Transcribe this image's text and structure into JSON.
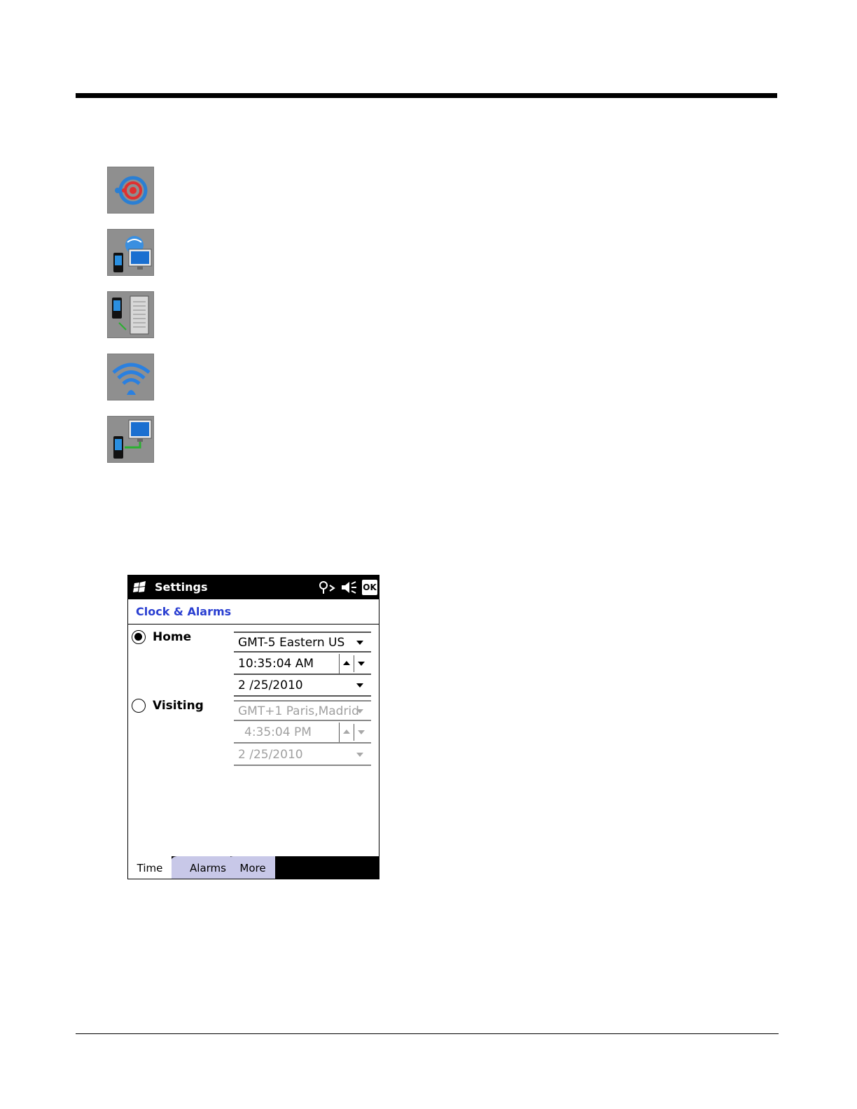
{
  "device_icons": [
    {
      "name": "bluetooth-discovery-icon"
    },
    {
      "name": "network-connection-icon"
    },
    {
      "name": "device-server-sync-icon"
    },
    {
      "name": "wireless-signal-icon"
    },
    {
      "name": "pc-connection-icon"
    }
  ],
  "phone": {
    "titlebar": {
      "title": "Settings",
      "ok_label": "OK"
    },
    "page_title": "Clock & Alarms",
    "home": {
      "label": "Home",
      "selected": true,
      "timezone": "GMT-5 Eastern US",
      "time": "10:35:04 AM",
      "date": "2 /25/2010"
    },
    "visiting": {
      "label": "Visiting",
      "selected": false,
      "timezone": "GMT+1 Paris,Madrid",
      "time": "4:35:04 PM",
      "date": "2 /25/2010"
    },
    "tabs": [
      {
        "label": "Time"
      },
      {
        "label": "Alarms"
      },
      {
        "label": "More"
      }
    ],
    "colors": {
      "header_blue": "#2a3fd1",
      "tab_inactive": "#c8c8e8"
    }
  }
}
